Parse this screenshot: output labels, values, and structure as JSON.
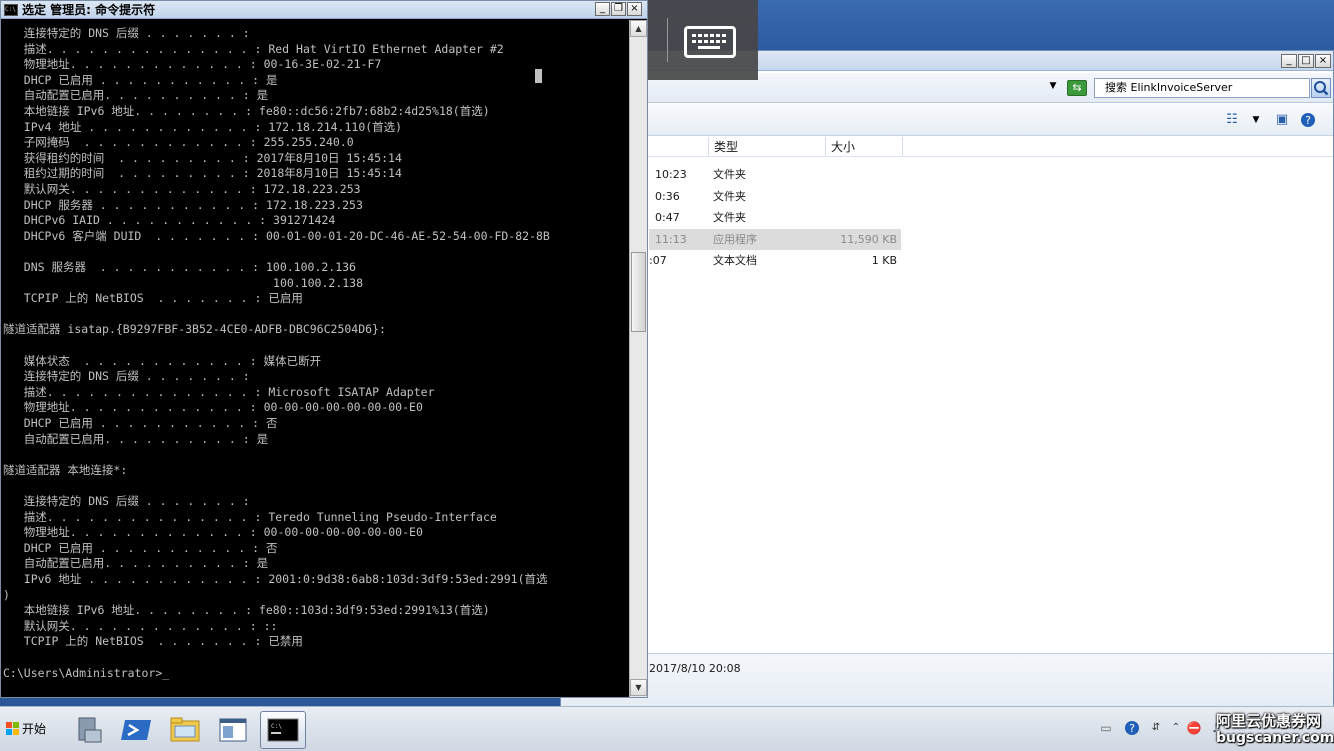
{
  "cmd": {
    "title": "选定 管理员: 命令提示符",
    "icon_text": "C:\\",
    "lines": [
      "   连接特定的 DNS 后缀 . . . . . . . :",
      "   描述. . . . . . . . . . . . . . . : Red Hat VirtIO Ethernet Adapter #2",
      "   物理地址. . . . . . . . . . . . . : 00-16-3E-02-21-F7",
      "   DHCP 已启用 . . . . . . . . . . . : 是",
      "   自动配置已启用. . . . . . . . . . : 是",
      "   本地链接 IPv6 地址. . . . . . . . : fe80::dc56:2fb7:68b2:4d25%18(首选)",
      "   IPv4 地址 . . . . . . . . . . . . : 172.18.214.110(首选)",
      "   子网掩码  . . . . . . . . . . . . : 255.255.240.0",
      "   获得租约的时间  . . . . . . . . . : 2017年8月10日 15:45:14",
      "   租约过期的时间  . . . . . . . . . : 2018年8月10日 15:45:14",
      "   默认网关. . . . . . . . . . . . . : 172.18.223.253",
      "   DHCP 服务器 . . . . . . . . . . . : 172.18.223.253",
      "   DHCPv6 IAID . . . . . . . . . . . : 391271424",
      "   DHCPv6 客户端 DUID  . . . . . . . : 00-01-00-01-20-DC-46-AE-52-54-00-FD-82-8B",
      "",
      "   DNS 服务器  . . . . . . . . . . . : 100.100.2.136",
      "                                       100.100.2.138",
      "   TCPIP 上的 NetBIOS  . . . . . . . : 已启用",
      "",
      "隧道适配器 isatap.{B9297FBF-3B52-4CE0-ADFB-DBC96C2504D6}:",
      "",
      "   媒体状态  . . . . . . . . . . . . : 媒体已断开",
      "   连接特定的 DNS 后缀 . . . . . . . :",
      "   描述. . . . . . . . . . . . . . . : Microsoft ISATAP Adapter",
      "   物理地址. . . . . . . . . . . . . : 00-00-00-00-00-00-00-E0",
      "   DHCP 已启用 . . . . . . . . . . . : 否",
      "   自动配置已启用. . . . . . . . . . : 是",
      "",
      "隧道适配器 本地连接*:",
      "",
      "   连接特定的 DNS 后缀 . . . . . . . :",
      "   描述. . . . . . . . . . . . . . . : Teredo Tunneling Pseudo-Interface",
      "   物理地址. . . . . . . . . . . . . : 00-00-00-00-00-00-00-E0",
      "   DHCP 已启用 . . . . . . . . . . . : 否",
      "   自动配置已启用. . . . . . . . . . : 是",
      "   IPv6 地址 . . . . . . . . . . . . : 2001:0:9d38:6ab8:103d:3df9:53ed:2991(首选",
      ")",
      "   本地链接 IPv6 地址. . . . . . . . : fe80::103d:3df9:53ed:2991%13(首选)",
      "   默认网关. . . . . . . . . . . . . : ::",
      "   TCPIP 上的 NetBIOS  . . . . . . . : 已禁用",
      "",
      "C:\\Users\\Administrator>_"
    ]
  },
  "explorer": {
    "search_text": "搜索 ElinkInvoiceServer",
    "columns": {
      "type": "类型",
      "size": "大小"
    },
    "rows": [
      {
        "time": "10:23",
        "type": "文件夹",
        "size": ""
      },
      {
        "time": "0:36",
        "type": "文件夹",
        "size": ""
      },
      {
        "time": "0:47",
        "type": "文件夹",
        "size": ""
      },
      {
        "time": "11:13",
        "type": "应用程序",
        "size": "11,590 KB",
        "selected": true
      },
      {
        "time": ":07",
        "type": "文本文档",
        "size": "1 KB"
      }
    ],
    "status_date": "2017/8/10 20:08"
  },
  "taskbar": {
    "start_label": "开始"
  },
  "watermark": {
    "line1": "阿里云优惠券网",
    "line2": "bugscaner.com"
  },
  "colors": {
    "cmd_bg": "#000000",
    "cmd_text": "#c0c0c0",
    "desktop": "#2b5797",
    "selected_row": "#dcdcdc"
  }
}
